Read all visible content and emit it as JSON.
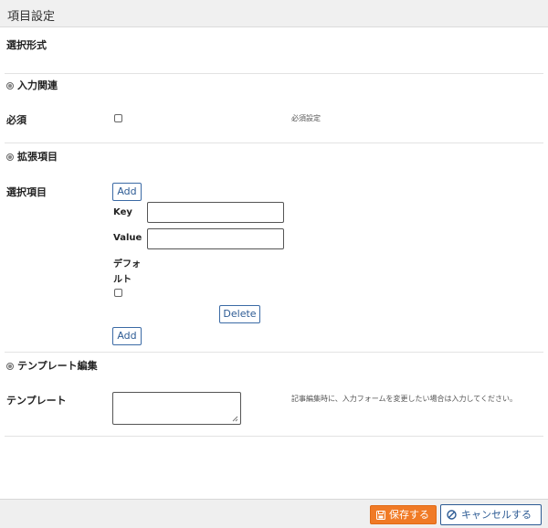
{
  "window": {
    "title": "項目設定"
  },
  "selection_format": {
    "label": "選択形式"
  },
  "input_section": {
    "title": "入力関連",
    "required_label": "必須",
    "required_hint": "必須設定",
    "required_checked": false
  },
  "extension_section": {
    "title": "拡張項目",
    "options_label": "選択項目",
    "add_label": "Add",
    "key_label": "Key",
    "key_value": "",
    "value_label": "Value",
    "value_value": "",
    "default_label_line1": "デフォ",
    "default_label_line2": "ルト",
    "default_checked": false,
    "delete_label": "Delete",
    "add_bottom_label": "Add"
  },
  "template_section": {
    "title": "テンプレート編集",
    "template_label": "テンプレート",
    "template_value": "",
    "template_hint": "記事編集時に、入力フォームを変更したい場合は入力してください。"
  },
  "footer": {
    "save_label": "保存する",
    "cancel_label": "キャンセルする"
  }
}
